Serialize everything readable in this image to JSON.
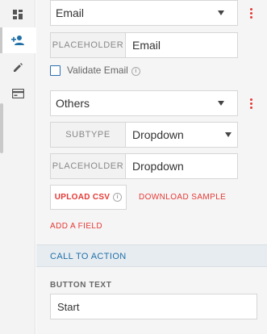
{
  "sidebar": {
    "items": [
      {
        "icon": "dashboard-icon",
        "label": ""
      },
      {
        "icon": "add-user-icon",
        "label": ""
      },
      {
        "icon": "pencil-icon",
        "label": ""
      },
      {
        "icon": "card-icon",
        "label": ""
      }
    ]
  },
  "fields": {
    "email": {
      "type_value": "Email",
      "placeholder_label": "PLACEHOLDER",
      "placeholder_value": "Email",
      "validate_label": "Validate Email"
    },
    "others": {
      "type_value": "Others",
      "subtype_label": "SUBTYPE",
      "subtype_value": "Dropdown",
      "placeholder_label": "PLACEHOLDER",
      "placeholder_value": "Dropdown",
      "upload_label": "UPLOAD CSV",
      "download_label": "DOWNLOAD SAMPLE"
    },
    "add_field_label": "ADD A FIELD"
  },
  "cta": {
    "section_title": "CALL TO ACTION",
    "button_text_label": "BUTTON TEXT",
    "button_text_value": "Start"
  },
  "colors": {
    "accent_red": "#e53935",
    "accent_blue": "#1f6fa7"
  }
}
